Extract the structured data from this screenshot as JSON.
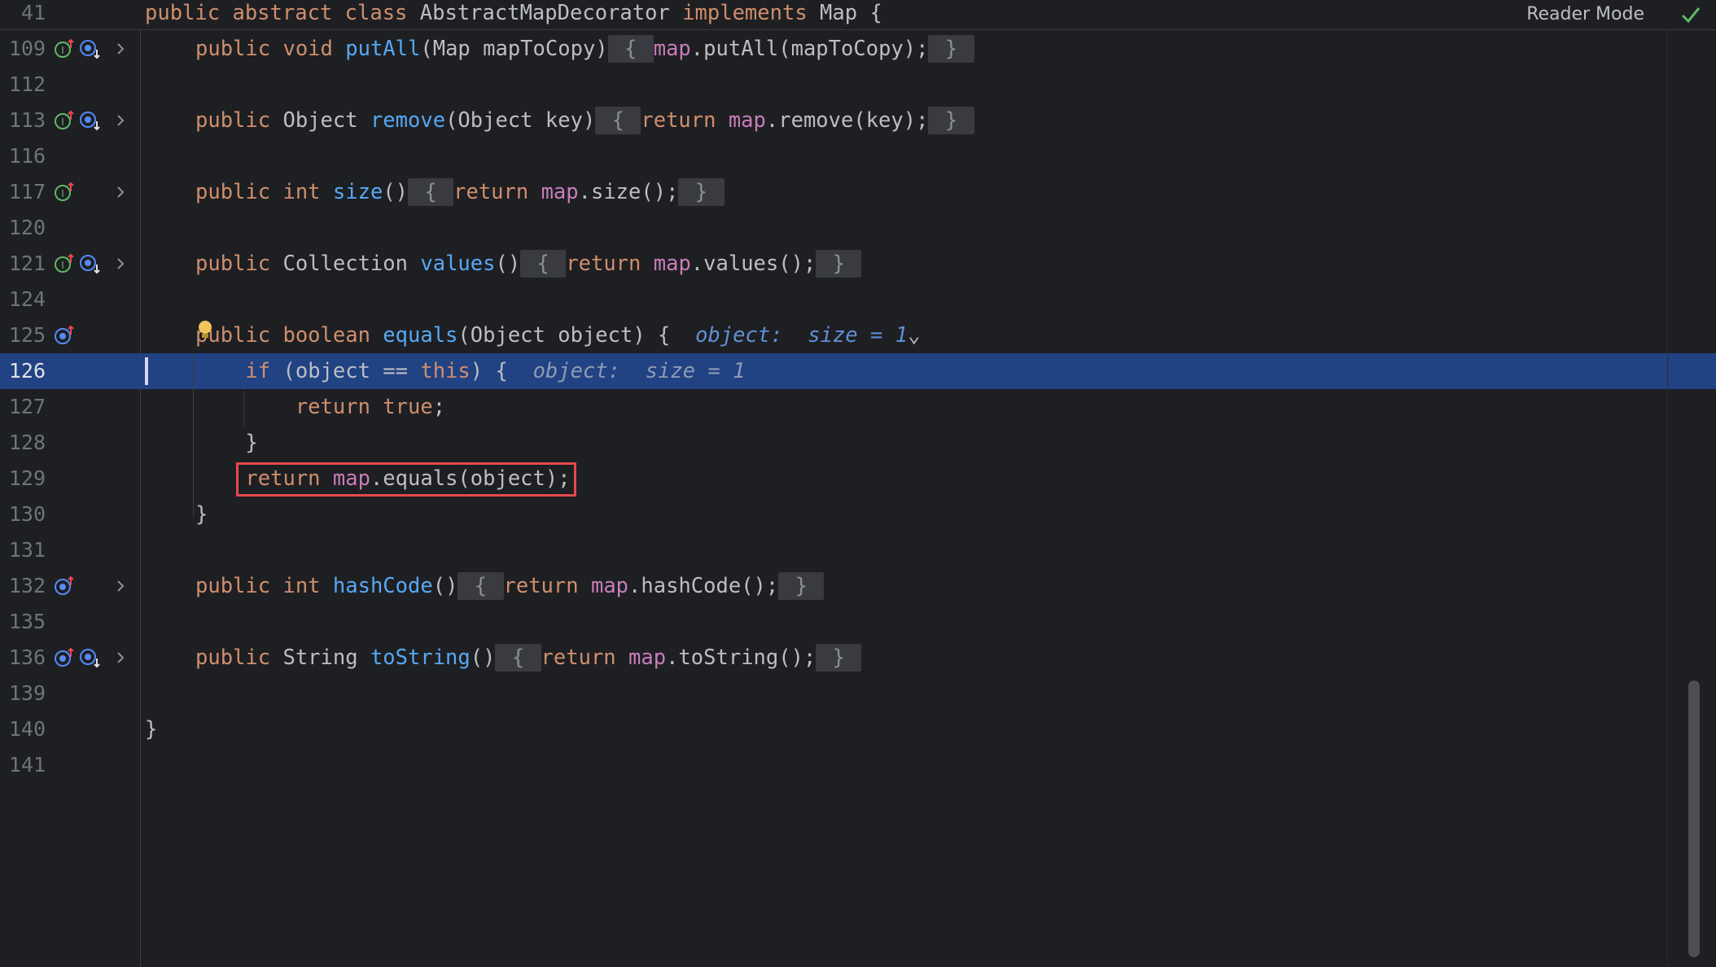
{
  "editor": {
    "sticky": {
      "line_no": "41",
      "text_parts": [
        "public abstract class ",
        "AbstractMapDecorator",
        " implements ",
        "Map {"
      ]
    },
    "reader_mode_label": "Reader Mode",
    "lines": [
      {
        "no": "109",
        "tokens": [
          [
            "kw",
            "public void "
          ],
          [
            "fn",
            "putAll"
          ],
          [
            "pl",
            "(Map mapToCopy)"
          ],
          [
            "fold",
            " { "
          ],
          [
            "fld",
            "map"
          ],
          [
            "pl",
            ".putAll(mapToCopy);"
          ],
          [
            "fold",
            " } "
          ]
        ]
      },
      {
        "no": "112"
      },
      {
        "no": "113",
        "tokens": [
          [
            "kw",
            "public "
          ],
          [
            "pl",
            "Object "
          ],
          [
            "fn",
            "remove"
          ],
          [
            "pl",
            "(Object key)"
          ],
          [
            "fold",
            " { "
          ],
          [
            "kw",
            "return "
          ],
          [
            "fld",
            "map"
          ],
          [
            "pl",
            ".remove(key);"
          ],
          [
            "fold",
            " } "
          ]
        ]
      },
      {
        "no": "116"
      },
      {
        "no": "117",
        "tokens": [
          [
            "kw",
            "public int "
          ],
          [
            "fn",
            "size"
          ],
          [
            "pl",
            "()"
          ],
          [
            "fold",
            " { "
          ],
          [
            "kw",
            "return "
          ],
          [
            "fld",
            "map"
          ],
          [
            "pl",
            ".size();"
          ],
          [
            "fold",
            " } "
          ]
        ]
      },
      {
        "no": "120"
      },
      {
        "no": "121",
        "tokens": [
          [
            "kw",
            "public "
          ],
          [
            "pl",
            "Collection "
          ],
          [
            "fn",
            "values"
          ],
          [
            "pl",
            "()"
          ],
          [
            "fold",
            " { "
          ],
          [
            "kw",
            "return "
          ],
          [
            "fld",
            "map"
          ],
          [
            "pl",
            ".values();"
          ],
          [
            "fold",
            " } "
          ]
        ]
      },
      {
        "no": "124"
      },
      {
        "no": "125",
        "tokens": [
          [
            "kw",
            "public boolean "
          ],
          [
            "fn",
            "equals"
          ],
          [
            "pl",
            "(Object object) {  "
          ],
          [
            "hint",
            "object:  size = 1"
          ],
          [
            "pl",
            "⌄"
          ]
        ]
      },
      {
        "no": "126",
        "tokens": [
          [
            "pl",
            "    "
          ],
          [
            "kw",
            "if "
          ],
          [
            "pl",
            "(object == "
          ],
          [
            "kw",
            "this"
          ],
          [
            "pl",
            ") {  "
          ],
          [
            "hint2",
            "object:  size = 1"
          ]
        ]
      },
      {
        "no": "127",
        "tokens": [
          [
            "pl",
            "        "
          ],
          [
            "kw",
            "return true"
          ],
          [
            "pl",
            ";"
          ]
        ]
      },
      {
        "no": "128",
        "tokens": [
          [
            "pl",
            "    }"
          ]
        ]
      },
      {
        "no": "129",
        "tokens": [
          [
            "pl",
            "    "
          ],
          [
            "kw",
            "return "
          ],
          [
            "fld",
            "map"
          ],
          [
            "pl",
            ".equals(object);"
          ]
        ]
      },
      {
        "no": "130",
        "tokens": [
          [
            "pl",
            "}"
          ]
        ]
      },
      {
        "no": "131"
      },
      {
        "no": "132",
        "tokens": [
          [
            "kw",
            "public int "
          ],
          [
            "fn",
            "hashCode"
          ],
          [
            "pl",
            "()"
          ],
          [
            "fold",
            " { "
          ],
          [
            "kw",
            "return "
          ],
          [
            "fld",
            "map"
          ],
          [
            "pl",
            ".hashCode();"
          ],
          [
            "fold",
            " } "
          ]
        ]
      },
      {
        "no": "135"
      },
      {
        "no": "136",
        "tokens": [
          [
            "kw",
            "public "
          ],
          [
            "pl",
            "String "
          ],
          [
            "fn",
            "toString"
          ],
          [
            "pl",
            "()"
          ],
          [
            "fold",
            " { "
          ],
          [
            "kw",
            "return "
          ],
          [
            "fld",
            "map"
          ],
          [
            "pl",
            ".toString();"
          ],
          [
            "fold",
            " } "
          ]
        ]
      },
      {
        "no": "139"
      },
      {
        "no": "140",
        "tokens": [
          [
            "pl",
            "}"
          ]
        ]
      },
      {
        "no": "141"
      }
    ]
  },
  "colors": {
    "background": "#1e1f22",
    "current_line": "#214283",
    "keyword": "#cf8e6d",
    "function": "#56a8f5",
    "field": "#c77dbb",
    "highlight_box": "#e5484d"
  },
  "icons": [
    "implements-up-icon",
    "overridden-down-icon",
    "override-up-icon",
    "fold-chevron-icon",
    "lightbulb-icon",
    "checkmark-icon"
  ]
}
